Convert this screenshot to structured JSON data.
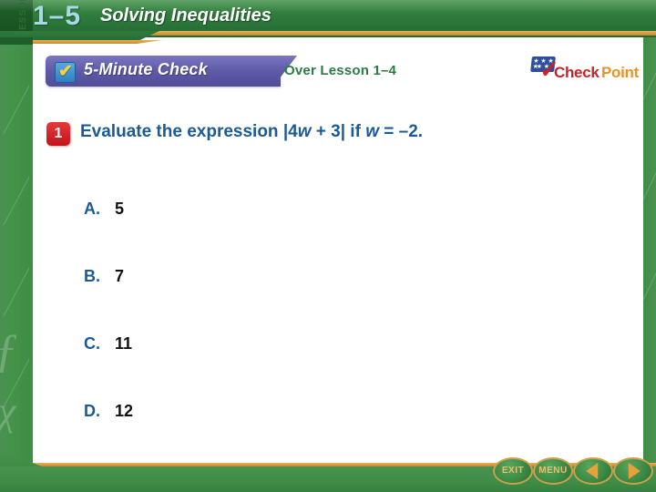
{
  "header": {
    "lesson_label": "LESSON",
    "lesson_number": "1–5",
    "title": "Solving Inequalities"
  },
  "check_banner": {
    "label": "5-Minute Check",
    "checkbox_icon": "checkbox-check-icon",
    "tick_glyph": "✔"
  },
  "over_lesson": "Over Lesson 1–4",
  "checkpoint_logo": {
    "check_word": "Check",
    "point_word": "Point",
    "flag_icon": "flag-stars-icon",
    "tick_glyph": "✓",
    "check_color": "#cc2127",
    "point_color": "#e8922a"
  },
  "question": {
    "number": "1",
    "prefix": "Evaluate the expression |4",
    "var1": "w",
    "middle": " + 3| if ",
    "var2": "w",
    "suffix": " = –2."
  },
  "choices": [
    {
      "letter": "A.",
      "value": "5"
    },
    {
      "letter": "B.",
      "value": "7"
    },
    {
      "letter": "C.",
      "value": "11"
    },
    {
      "letter": "D.",
      "value": "12"
    }
  ],
  "footer": {
    "exit_label": "EXIT",
    "menu_label": "MENU",
    "back_icon": "arrow-left-icon",
    "next_icon": "arrow-right-icon"
  }
}
